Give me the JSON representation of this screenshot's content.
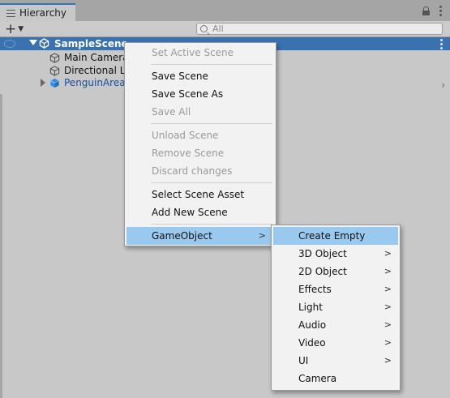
{
  "window": {
    "tab_title": "Hierarchy",
    "search_placeholder": "All"
  },
  "hierarchy": {
    "scene_name": "SampleScene",
    "items": [
      {
        "label": "Main Camera",
        "type": "gameobject-icon"
      },
      {
        "label": "Directional Li",
        "type": "gameobject-icon"
      },
      {
        "label": "PenguinAreat",
        "type": "prefab-icon"
      }
    ]
  },
  "context_menu": {
    "items": [
      {
        "label": "Set Active Scene",
        "enabled": false
      },
      {
        "label": "Save Scene",
        "enabled": true
      },
      {
        "label": "Save Scene As",
        "enabled": true
      },
      {
        "label": "Save All",
        "enabled": false
      },
      {
        "label": "Unload Scene",
        "enabled": false
      },
      {
        "label": "Remove Scene",
        "enabled": false
      },
      {
        "label": "Discard changes",
        "enabled": false
      },
      {
        "label": "Select Scene Asset",
        "enabled": true
      },
      {
        "label": "Add New Scene",
        "enabled": true
      },
      {
        "label": "GameObject",
        "enabled": true,
        "submenu": true,
        "highlighted": true
      }
    ]
  },
  "submenu": {
    "items": [
      {
        "label": "Create Empty",
        "has_arrow": false,
        "highlighted": true
      },
      {
        "label": "3D Object",
        "has_arrow": true
      },
      {
        "label": "2D Object",
        "has_arrow": true
      },
      {
        "label": "Effects",
        "has_arrow": true
      },
      {
        "label": "Light",
        "has_arrow": true
      },
      {
        "label": "Audio",
        "has_arrow": true
      },
      {
        "label": "Video",
        "has_arrow": true
      },
      {
        "label": "UI",
        "has_arrow": true
      },
      {
        "label": "Camera",
        "has_arrow": false
      }
    ]
  },
  "colors": {
    "selection": "#3a72b0",
    "menu_highlight": "#99c9ef",
    "panel_bg": "#c8c8c8",
    "menu_bg": "#f2f2f2"
  }
}
